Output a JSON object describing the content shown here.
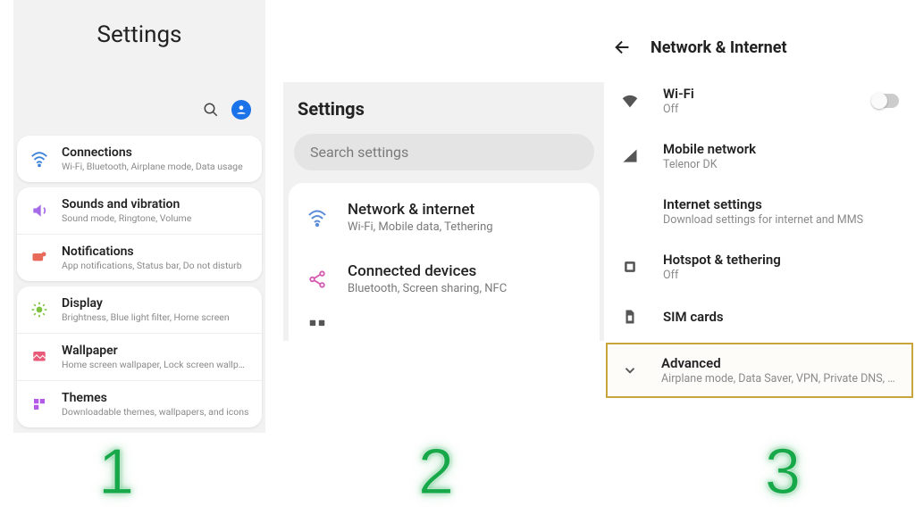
{
  "panel1": {
    "title": "Settings",
    "items": [
      {
        "label": "Connections",
        "sub": "Wi-Fi, Bluetooth, Airplane mode, Data usage"
      },
      {
        "label": "Sounds and vibration",
        "sub": "Sound mode, Ringtone, Volume"
      },
      {
        "label": "Notifications",
        "sub": "App notifications, Status bar, Do not disturb"
      },
      {
        "label": "Display",
        "sub": "Brightness, Blue light filter, Home screen"
      },
      {
        "label": "Wallpaper",
        "sub": "Home screen wallpaper, Lock screen wallpaper"
      },
      {
        "label": "Themes",
        "sub": "Downloadable themes, wallpapers, and icons"
      }
    ]
  },
  "panel2": {
    "title": "Settings",
    "search_placeholder": "Search settings",
    "items": [
      {
        "label": "Network & internet",
        "sub": "Wi-Fi, Mobile data, Tethering"
      },
      {
        "label": "Connected devices",
        "sub": "Bluetooth, Screen sharing, NFC"
      }
    ]
  },
  "panel3": {
    "title": "Network & Internet",
    "items": [
      {
        "label": "Wi-Fi",
        "sub": "Off",
        "toggle": true
      },
      {
        "label": "Mobile network",
        "sub": "Telenor DK"
      },
      {
        "label": "Internet settings",
        "sub": "Download settings for internet and MMS"
      },
      {
        "label": "Hotspot & tethering",
        "sub": "Off"
      },
      {
        "label": "SIM cards",
        "sub": ""
      }
    ],
    "advanced": {
      "label": "Advanced",
      "sub": "Airplane mode, Data Saver, VPN, Private DNS, Sm"
    }
  },
  "steps": {
    "one": "1",
    "two": "2",
    "three": "3"
  }
}
